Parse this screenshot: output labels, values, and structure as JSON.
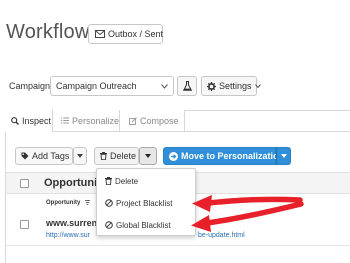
{
  "header": {
    "title": "Workflow",
    "outbox_label": "Outbox / Sent"
  },
  "campaign": {
    "label": "Campaign:",
    "value": "Campaign Outreach",
    "settings_label": "Settings"
  },
  "tabs": [
    {
      "label": "Inspect",
      "active": true
    },
    {
      "label": "Personalize",
      "active": false
    },
    {
      "label": "Compose",
      "active": false
    }
  ],
  "toolbar": {
    "add_tags_label": "Add Tags",
    "delete_label": "Delete",
    "move_label": "Move to Personalization"
  },
  "dropdown": {
    "items": [
      "Delete",
      "Project Blacklist",
      "Global Blacklist"
    ]
  },
  "table": {
    "header": "Opportunity",
    "sub_header": "Opportunity",
    "row_title": "www.surrend",
    "row_link_left": "http://www.sur",
    "row_link_right": "be-update.html"
  },
  "colors": {
    "primary": "#2f8fd8",
    "annotation": "#e8202a",
    "link": "#2a6fb5"
  }
}
